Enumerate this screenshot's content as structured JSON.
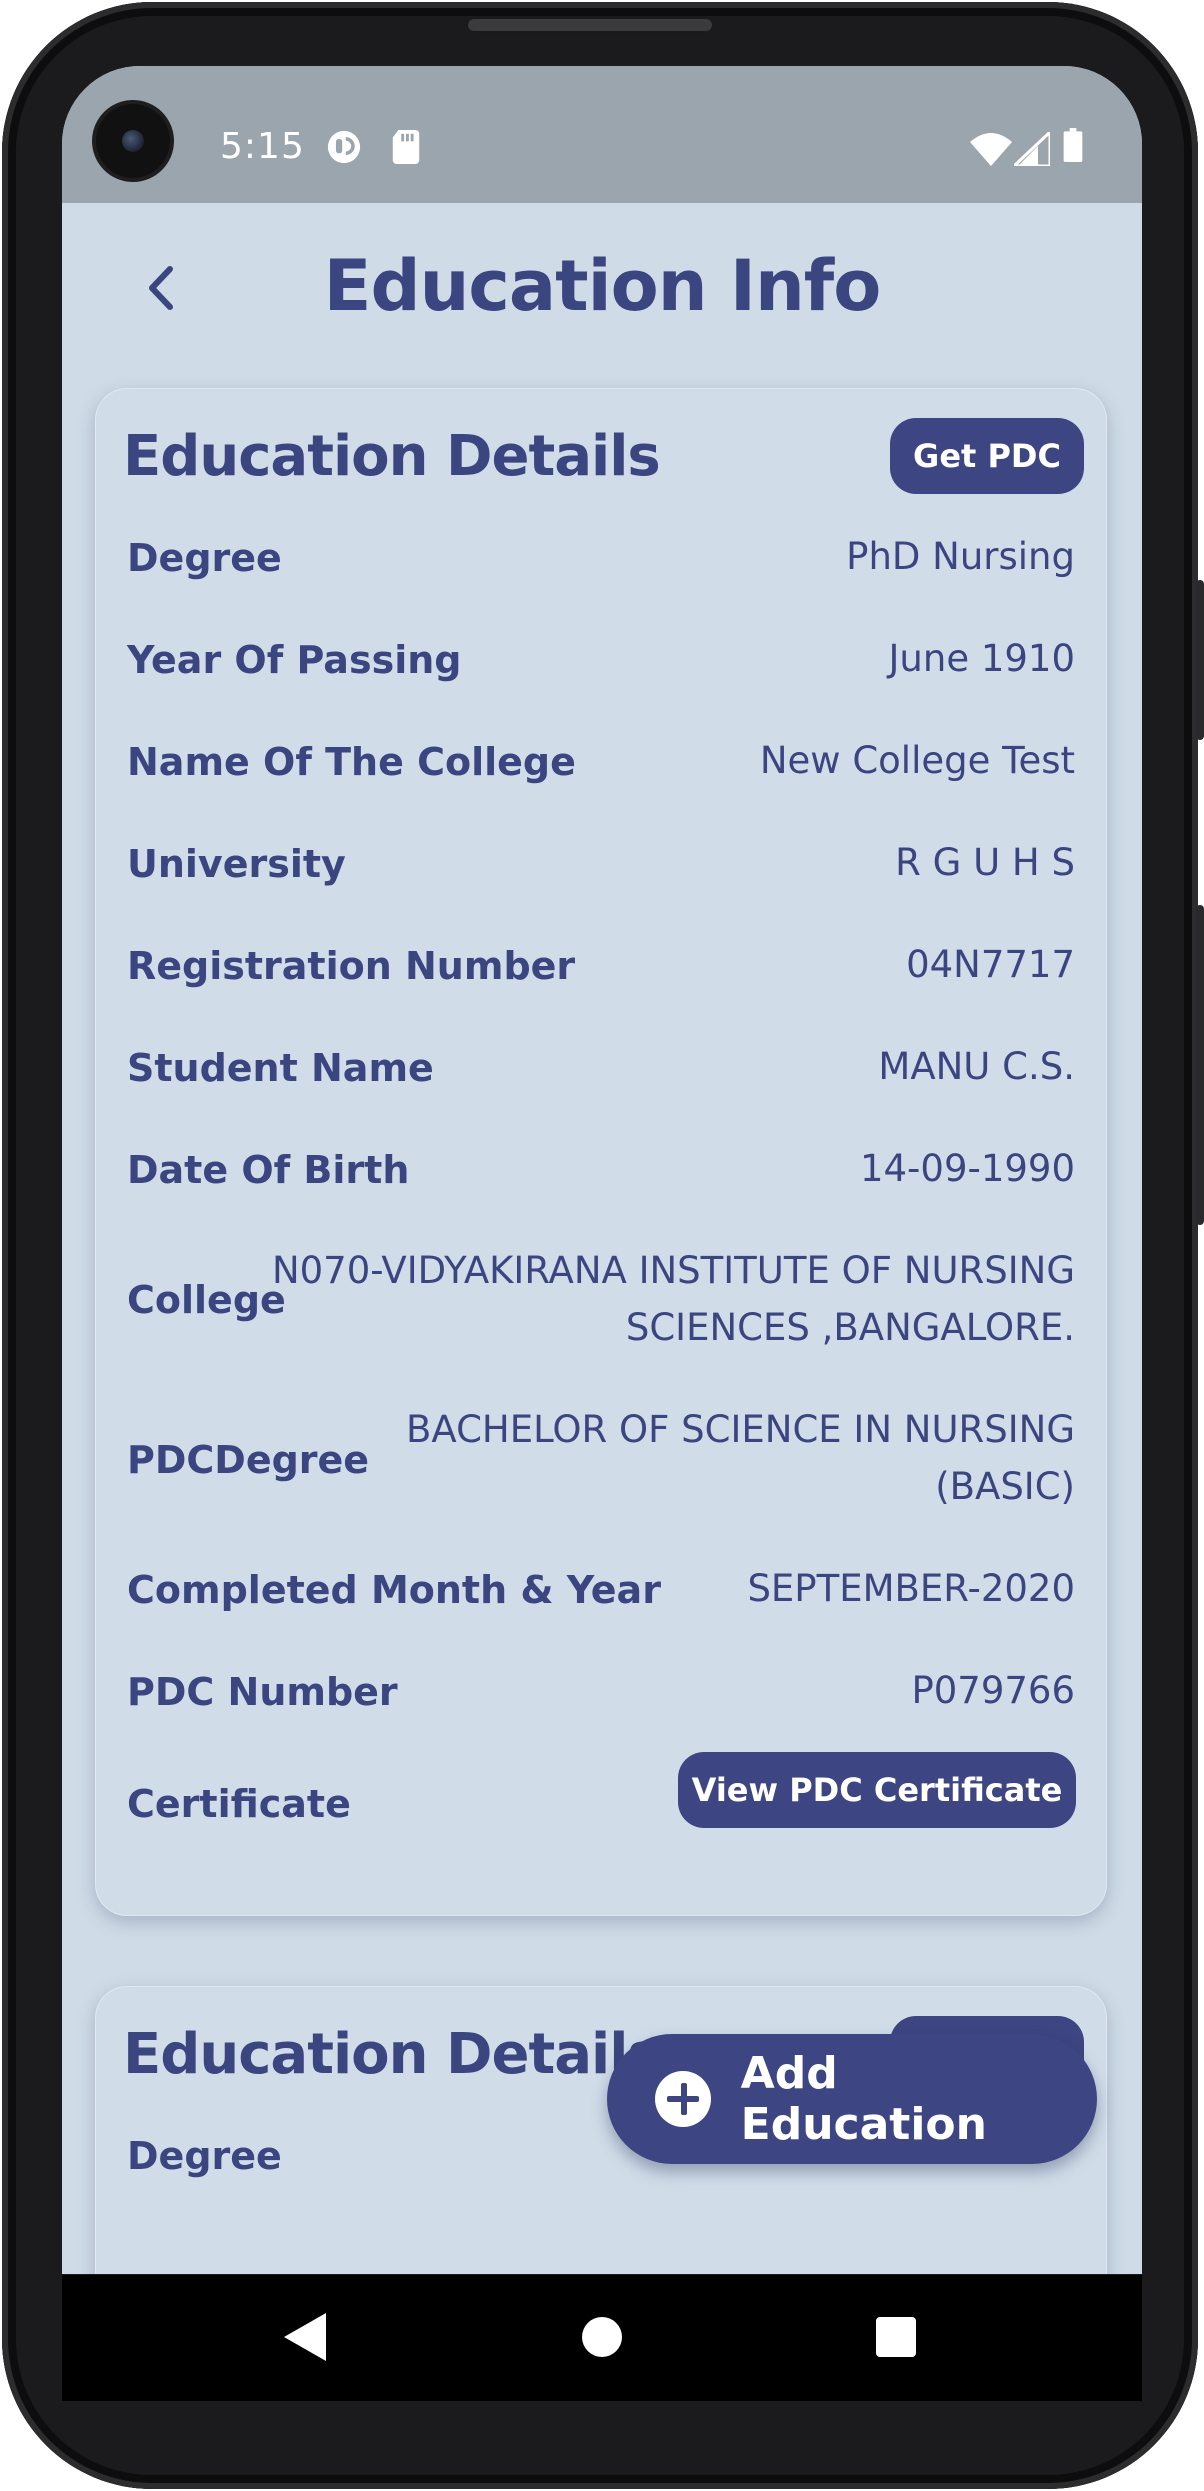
{
  "status_bar": {
    "time": "5:15",
    "icons": [
      "headset-icon",
      "sd-card-icon",
      "wifi-icon",
      "signal-icon",
      "battery-icon"
    ]
  },
  "header": {
    "title": "Education Info",
    "back_icon": "chevron-left-icon"
  },
  "cards": [
    {
      "title": "Education Details",
      "pdc_button": "Get PDC",
      "rows": [
        {
          "label": "Degree",
          "value": "PhD Nursing"
        },
        {
          "label": "Year Of Passing",
          "value": "June 1910"
        },
        {
          "label": "Name Of The College",
          "value": "New College Test"
        },
        {
          "label": "University",
          "value": "R G U H S"
        },
        {
          "label": "Registration Number",
          "value": "04N7717"
        },
        {
          "label": "Student Name",
          "value": "MANU C.S."
        },
        {
          "label": "Date Of Birth",
          "value": "14-09-1990"
        },
        {
          "label": "College",
          "value_line1": "N070-VIDYAKIRANA INSTITUTE OF NURSING",
          "value_line2": "SCIENCES ,BANGALORE."
        },
        {
          "label": "PDCDegree",
          "value_line1": "BACHELOR OF SCIENCE IN NURSING",
          "value_line2": "(BASIC)"
        },
        {
          "label": "Completed Month & Year",
          "value": "SEPTEMBER-2020"
        },
        {
          "label": "PDC Number",
          "value": "P079766"
        },
        {
          "label": "Certificate",
          "button": "View PDC Certificate"
        }
      ]
    },
    {
      "title": "Education Details",
      "pdc_button": "Get PDC",
      "rows": [
        {
          "label": "Degree"
        }
      ]
    }
  ],
  "fab": {
    "label": "Add Education",
    "icon": "plus-circle-icon"
  },
  "colors": {
    "primary": "#3d4682",
    "text": "#3b4580",
    "background": "#cfdce8",
    "status_bar": "#9aa5ae"
  },
  "nav_bar": {
    "icons": [
      "back-triangle-icon",
      "home-circle-icon",
      "recents-square-icon"
    ]
  }
}
